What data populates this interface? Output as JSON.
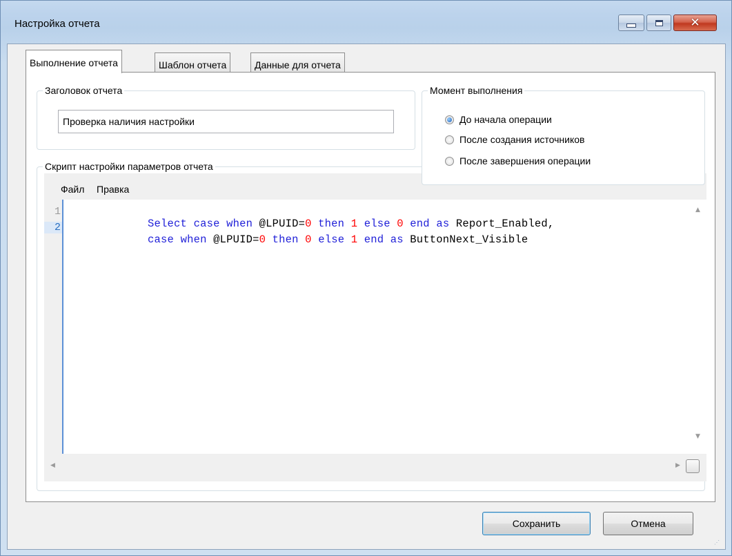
{
  "window": {
    "title": "Настройка отчета"
  },
  "tabs": [
    {
      "label": "Выполнение отчета"
    },
    {
      "label": "Шаблон отчета"
    },
    {
      "label": "Данные для отчета"
    }
  ],
  "header_group": {
    "legend": "Заголовок отчета",
    "value": "Проверка наличия настройки"
  },
  "timing_group": {
    "legend": "Момент выполнения",
    "options": [
      {
        "label": "До начала операции",
        "checked": true
      },
      {
        "label": "После создания источников",
        "checked": false
      },
      {
        "label": "После завершения операции",
        "checked": false
      }
    ]
  },
  "script_group": {
    "legend": "Скрипт настройки параметров отчета",
    "menu": [
      {
        "label": "Файл"
      },
      {
        "label": "Правка"
      }
    ],
    "line_numbers": [
      "1",
      "2"
    ],
    "code_lines": [
      [
        "Select",
        " ",
        "case",
        " ",
        "when",
        " @LPUID=",
        "0",
        " ",
        "then",
        " ",
        "1",
        " ",
        "else",
        " ",
        "0",
        " ",
        "end",
        " ",
        "as",
        " Report_Enabled,"
      ],
      [
        "case",
        " ",
        "when",
        " @LPUID=",
        "0",
        " ",
        "then",
        " ",
        "0",
        " ",
        "else",
        " ",
        "1",
        " ",
        "end",
        " ",
        "as",
        " ButtonNext_Visible"
      ]
    ]
  },
  "buttons": {
    "save": "Сохранить",
    "cancel": "Отмена"
  }
}
